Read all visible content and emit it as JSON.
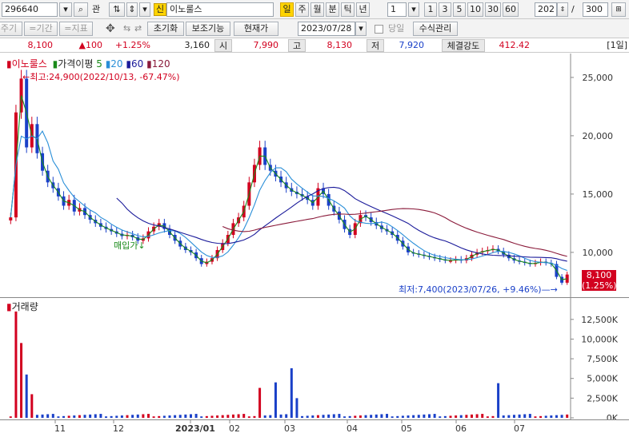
{
  "toolbar": {
    "code": "296640",
    "search_icon": "magnifier-icon",
    "gwan_label": "관",
    "shin_label": "신",
    "stock_name": "이노룰스",
    "period_buttons": [
      "일",
      "주",
      "월",
      "분",
      "틱",
      "년"
    ],
    "active_period": "일",
    "interval_value": "1",
    "minute_buttons": [
      "1",
      "3",
      "5",
      "10",
      "30",
      "60"
    ],
    "count_value": "202",
    "separator": "/",
    "total_value": "300"
  },
  "toolbar2": {
    "faded_labels": [
      "주기",
      "=기간",
      "=지표"
    ],
    "move_icon": "crosshair-move-icon",
    "buttons": [
      "초기화",
      "보조기능",
      "현재가"
    ],
    "date_value": "2023/07/28",
    "today_label": "당일",
    "formula_label": "수식관리"
  },
  "info": {
    "price": "8,100",
    "change": "▲100",
    "change_pct": "+1.25%",
    "volume": "3,160",
    "open_label": "시",
    "open": "7,990",
    "high_label": "고",
    "high": "8,130",
    "low_label": "저",
    "low": "7,920",
    "strength_label": "체결강도",
    "strength": "412.42",
    "period_badge": "[1일]"
  },
  "legend": {
    "name": "이노룰스",
    "ma_label": "가격이평",
    "ma_periods": [
      "5",
      "20",
      "60",
      "120"
    ],
    "ma_colors": [
      "#1a8a1a",
      "#2a8fd8",
      "#1a1a9a",
      "#8a1a3a"
    ]
  },
  "annotations": {
    "high": "←최고:24,900(2022/10/13, -67.47%)",
    "low": "최저:7,400(2023/07/26, +9.46%)—→",
    "buy_signal": "매입가↓",
    "current_tag_price": "8,100",
    "current_tag_pct": "(1.25%)"
  },
  "volume_label": "거래량",
  "colors": {
    "up": "#d2001f",
    "down": "#1a40c8",
    "accent": "#ffd400"
  },
  "chart_data": [
    {
      "type": "candlestick",
      "title": "이노룰스",
      "y_ticks": [
        "25,000",
        "20,000",
        "15,000",
        "10,000"
      ],
      "ylim": [
        6500,
        26500
      ],
      "x_ticks": [
        "11",
        "12",
        "2023/01",
        "02",
        "03",
        "04",
        "05",
        "06",
        "07"
      ],
      "series": [
        {
          "name": "이노룰스",
          "close_path": [
            [
              0,
              13000
            ],
            [
              1,
              22000
            ],
            [
              2,
              24900
            ],
            [
              3,
              19000
            ],
            [
              4,
              21000
            ],
            [
              5,
              18500
            ],
            [
              6,
              17000
            ],
            [
              7,
              16000
            ],
            [
              8,
              15500
            ],
            [
              9,
              14800
            ],
            [
              10,
              14000
            ],
            [
              11,
              14500
            ],
            [
              12,
              13500
            ],
            [
              13,
              13800
            ],
            [
              14,
              13200
            ],
            [
              15,
              12800
            ],
            [
              16,
              12500
            ],
            [
              17,
              12200
            ],
            [
              18,
              12000
            ],
            [
              19,
              11800
            ],
            [
              20,
              11600
            ],
            [
              21,
              11400
            ],
            [
              22,
              11500
            ],
            [
              23,
              11300
            ],
            [
              24,
              11000
            ],
            [
              25,
              11200
            ],
            [
              26,
              11800
            ],
            [
              27,
              12200
            ],
            [
              28,
              12500
            ],
            [
              29,
              12000
            ],
            [
              30,
              11500
            ],
            [
              31,
              11000
            ],
            [
              32,
              10500
            ],
            [
              33,
              10200
            ],
            [
              34,
              10000
            ],
            [
              35,
              9500
            ],
            [
              36,
              9000
            ],
            [
              37,
              9200
            ],
            [
              38,
              9500
            ],
            [
              39,
              10200
            ],
            [
              40,
              10800
            ],
            [
              41,
              11500
            ],
            [
              42,
              12500
            ],
            [
              43,
              13000
            ],
            [
              44,
              14000
            ],
            [
              45,
              16000
            ],
            [
              46,
              17500
            ],
            [
              47,
              19000
            ],
            [
              48,
              17500
            ],
            [
              49,
              17000
            ],
            [
              50,
              16500
            ],
            [
              51,
              16000
            ],
            [
              52,
              15500
            ],
            [
              53,
              15200
            ],
            [
              54,
              15000
            ],
            [
              55,
              14800
            ],
            [
              56,
              14500
            ],
            [
              57,
              14000
            ],
            [
              58,
              15500
            ],
            [
              59,
              15000
            ],
            [
              60,
              14000
            ],
            [
              61,
              13500
            ],
            [
              62,
              12800
            ],
            [
              63,
              12000
            ],
            [
              64,
              11500
            ],
            [
              65,
              12500
            ],
            [
              66,
              13200
            ],
            [
              67,
              13000
            ],
            [
              68,
              12600
            ],
            [
              69,
              12300
            ],
            [
              70,
              12000
            ],
            [
              71,
              11800
            ],
            [
              72,
              11500
            ],
            [
              73,
              11000
            ],
            [
              74,
              10500
            ],
            [
              75,
              10000
            ],
            [
              76,
              9900
            ],
            [
              77,
              9800
            ],
            [
              78,
              9700
            ],
            [
              79,
              9600
            ],
            [
              80,
              9500
            ],
            [
              81,
              9400
            ],
            [
              82,
              9300
            ],
            [
              83,
              9300
            ],
            [
              84,
              9400
            ],
            [
              85,
              9300
            ],
            [
              86,
              9500
            ],
            [
              87,
              9800
            ],
            [
              88,
              10000
            ],
            [
              89,
              10100
            ],
            [
              90,
              10200
            ],
            [
              91,
              10300
            ],
            [
              92,
              10100
            ],
            [
              93,
              9800
            ],
            [
              94,
              9500
            ],
            [
              95,
              9300
            ],
            [
              96,
              9200
            ],
            [
              97,
              9100
            ],
            [
              98,
              9000
            ],
            [
              99,
              9100
            ],
            [
              100,
              9200
            ],
            [
              101,
              9100
            ],
            [
              102,
              9000
            ],
            [
              103,
              7900
            ],
            [
              104,
              7400
            ],
            [
              105,
              8100
            ]
          ]
        },
        {
          "name": "5",
          "values": "moving average of 이노룰스"
        },
        {
          "name": "20",
          "values": "moving average of 이노룰스"
        },
        {
          "name": "60",
          "values": "moving average of 이노룰스"
        },
        {
          "name": "120",
          "values": "moving average of 이노룰스"
        }
      ]
    },
    {
      "type": "bar",
      "title": "거래량",
      "y_ticks": [
        "12,500K",
        "10,000K",
        "7,500K",
        "5,000K",
        "2,500K",
        "0K"
      ],
      "ylim": [
        0,
        14000
      ],
      "spikes": [
        {
          "x": 1,
          "value": 13500
        },
        {
          "x": 2,
          "value": 9500
        },
        {
          "x": 3,
          "value": 5500
        },
        {
          "x": 4,
          "value": 3000
        },
        {
          "x": 47,
          "value": 3800
        },
        {
          "x": 50,
          "value": 4500
        },
        {
          "x": 53,
          "value": 6300
        },
        {
          "x": 54,
          "value": 2500
        },
        {
          "x": 92,
          "value": 4400
        }
      ]
    }
  ]
}
